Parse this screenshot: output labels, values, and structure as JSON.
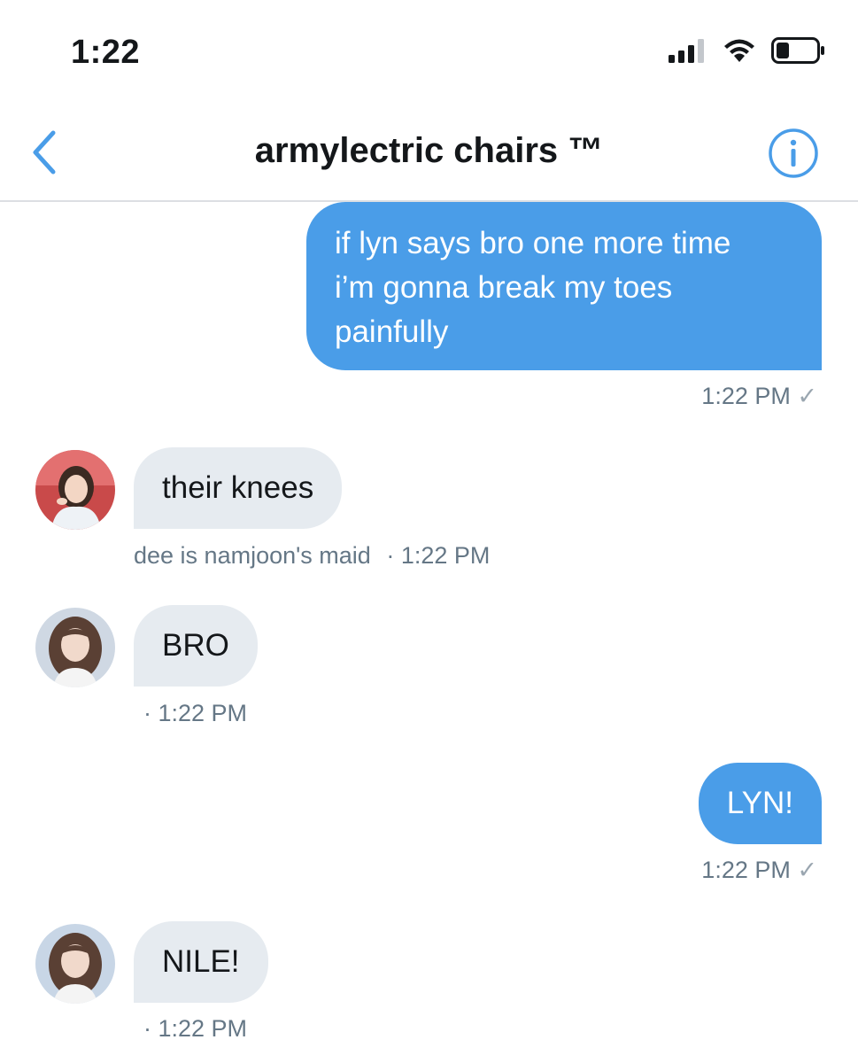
{
  "status_bar": {
    "time": "1:22",
    "icons": [
      "cellular-signal-icon",
      "wifi-icon",
      "battery-icon"
    ]
  },
  "header": {
    "title": "armylectric chairs ™",
    "back_icon": "chevron-left-icon",
    "info_icon": "info-icon"
  },
  "messages": [
    {
      "direction": "outgoing",
      "lines": [
        "if lyn says bro one more time",
        "i’m gonna break my toes",
        "painfully"
      ],
      "time": "1:22 PM",
      "check": "✓"
    },
    {
      "direction": "incoming",
      "text": "their knees",
      "sender": "dee is namjoon's maid",
      "time": "· 1:22 PM"
    },
    {
      "direction": "incoming",
      "text": "BRO",
      "time": "· 1:22 PM"
    },
    {
      "direction": "outgoing",
      "text": "LYN!",
      "time": "1:22 PM",
      "check": "✓"
    },
    {
      "direction": "incoming",
      "text": "NILE!",
      "time": "· 1:22 PM"
    }
  ],
  "colors": {
    "accent": "#4a9de8",
    "incoming_bubble": "#e6ebf0",
    "meta_text": "#657786"
  }
}
